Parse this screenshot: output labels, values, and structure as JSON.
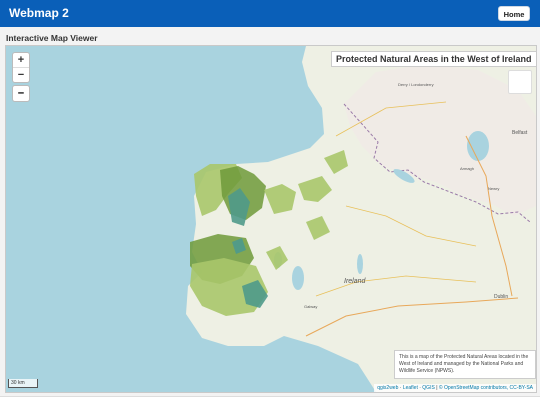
{
  "navbar": {
    "brand": "Webmap 2",
    "home_label": "Home"
  },
  "page": {
    "heading": "Interactive Map Viewer"
  },
  "map": {
    "title": "Protected Natural Areas in the West of Ireland",
    "zoom_in": "+",
    "zoom_out": "−",
    "measure_icon": "ruler-icon",
    "description": "This is a map of the Protected Natural Areas located in the West of Ireland and managed by the National Parks and Wildlife Service (NPWS).",
    "scale_label": "30 km",
    "attribution": {
      "qgis2web": "qgis2web",
      "leaflet": "Leaflet",
      "qgis": "QGIS",
      "osm": "© OpenStreetMap contributors, CC-BY-SA"
    },
    "place_labels": {
      "ireland": "Ireland",
      "belfast": "Belfast",
      "dublin": "Dublin",
      "derry": "Derry / Londonderry",
      "armagh": "Armagh",
      "newry": "Newry",
      "galway": "Galway"
    },
    "colors": {
      "sea": "#a9d3df",
      "land": "#eef0e4",
      "protected_light": "#a8c76a",
      "protected_dark": "#6e9a3a",
      "protected_teal": "#4f9a8a",
      "border": "#9a7aa8"
    }
  }
}
